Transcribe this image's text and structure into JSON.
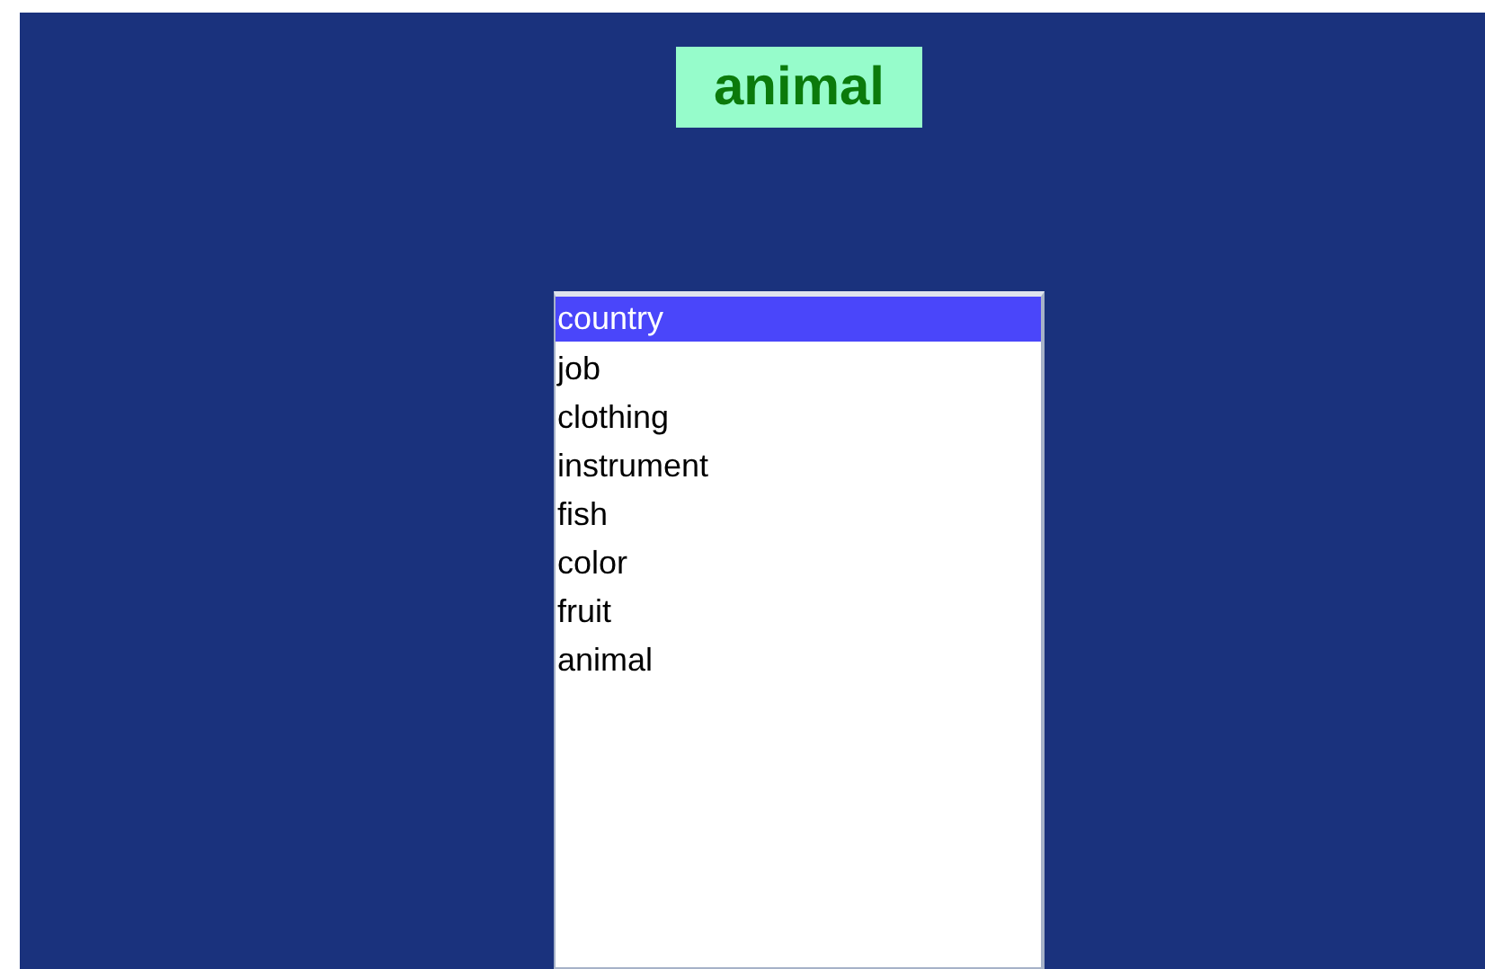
{
  "label": {
    "text": "animal"
  },
  "list": {
    "items": [
      {
        "text": "country",
        "selected": true
      },
      {
        "text": "job",
        "selected": false
      },
      {
        "text": "clothing",
        "selected": false
      },
      {
        "text": "instrument",
        "selected": false
      },
      {
        "text": "fish",
        "selected": false
      },
      {
        "text": "color",
        "selected": false
      },
      {
        "text": "fruit",
        "selected": false
      },
      {
        "text": "animal",
        "selected": false
      }
    ]
  }
}
